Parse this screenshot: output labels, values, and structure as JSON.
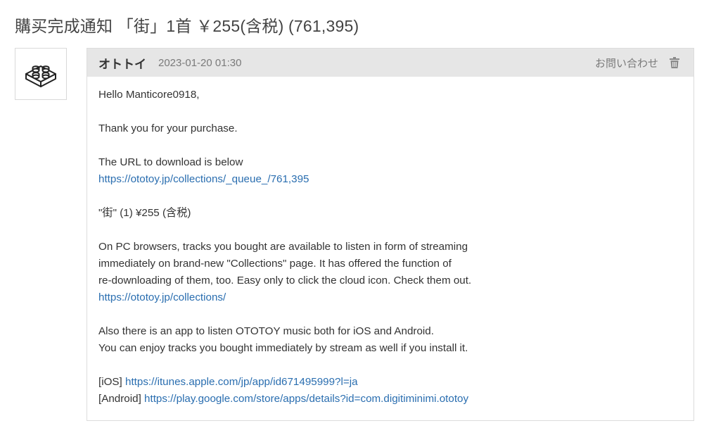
{
  "page": {
    "title": "購买完成通知 「街」1首 ￥255(含税) (761,395)"
  },
  "avatar": {
    "icon": "lego-brick-icon"
  },
  "message": {
    "sender": "オトトイ",
    "timestamp": "2023-01-20 01:30",
    "contact_label": "お問い合わせ",
    "delete_icon": "trash-icon",
    "body": {
      "greeting": "Hello Manticore0918,",
      "thanks": "Thank you for your purchase.",
      "download_intro": "The URL to download is below",
      "download_url": "https://ototoy.jp/collections/_queue_/761,395",
      "item_line": "\"街\" (1) ¥255 (含税)",
      "collections_p1": "On PC browsers, tracks you bought are available to listen in form of streaming",
      "collections_p2": "immediately on brand-new \"Collections\" page. It has offered the function of",
      "collections_p3": "re-downloading of them, too. Easy only to click the cloud icon. Check them out.",
      "collections_url": "https://ototoy.jp/collections/",
      "app_p1": "Also there is an app to listen OTOTOY music both for iOS and Android.",
      "app_p2": "You can enjoy tracks you bought immediately by stream as well if you install it.",
      "ios_label": "[iOS]",
      "ios_url": "https://itunes.apple.com/jp/app/id671495999?l=ja",
      "android_label": "[Android]",
      "android_url": "https://play.google.com/store/apps/details?id=com.digitiminimi.ototoy"
    }
  }
}
